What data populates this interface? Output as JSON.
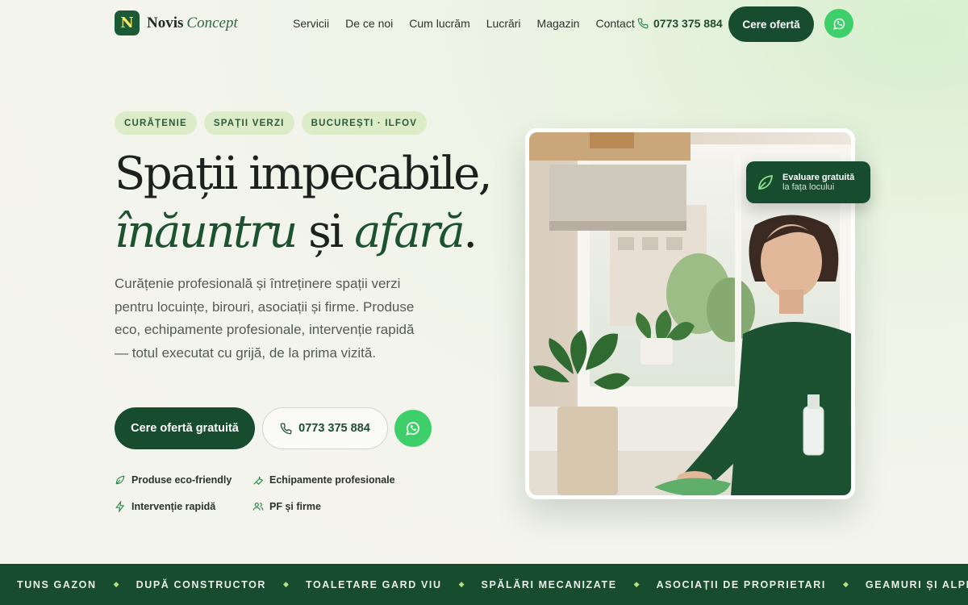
{
  "brand": {
    "mark": "N",
    "name": "Novis",
    "name_accent": "Concept"
  },
  "nav": {
    "links": [
      "Servicii",
      "De ce noi",
      "Cum lucrăm",
      "Lucrări",
      "Magazin",
      "Contact"
    ],
    "phone": "0773 375 884",
    "cta": "Cere ofertă"
  },
  "hero": {
    "tags": [
      "CURĂȚENIE",
      "SPAȚII VERZI",
      "BUCUREȘTI · ILFOV"
    ],
    "title_line1": "Spații impecabile,",
    "title_word1": "înăuntru",
    "title_mid": " și ",
    "title_word2": "afară",
    "title_end": ".",
    "lead": "Curățenie profesională și întreținere spații verzi pentru locuințe, birouri, asociații și firme. Produse eco, echipamente profesionale, intervenție rapidă — totul executat cu grijă, de la prima vizită.",
    "cta_primary": "Cere ofertă gratuită",
    "cta_phone": "0773 375 884",
    "features": [
      "Produse eco-friendly",
      "Echipamente profesionale",
      "Intervenție rapidă",
      "PF și firme"
    ]
  },
  "badge": {
    "title": "Evaluare gratuită",
    "subtitle": "la fața locului"
  },
  "marquee": [
    "TUNS GAZON",
    "DUPĂ CONSTRUCTOR",
    "TOALETARE GARD VIU",
    "SPĂLĂRI MECANIZATE",
    "ASOCIAȚII DE PROPRIETARI",
    "GEAMURI ȘI ALPINISM UTILITAR"
  ],
  "colors": {
    "primary": "#174d2e",
    "whatsapp": "#3fcf6a",
    "tag_bg": "#dcebc8",
    "accent": "#b8e07a"
  },
  "icons": {
    "phone": "phone-icon",
    "whatsapp": "whatsapp-icon",
    "leaf": "leaf-icon"
  }
}
